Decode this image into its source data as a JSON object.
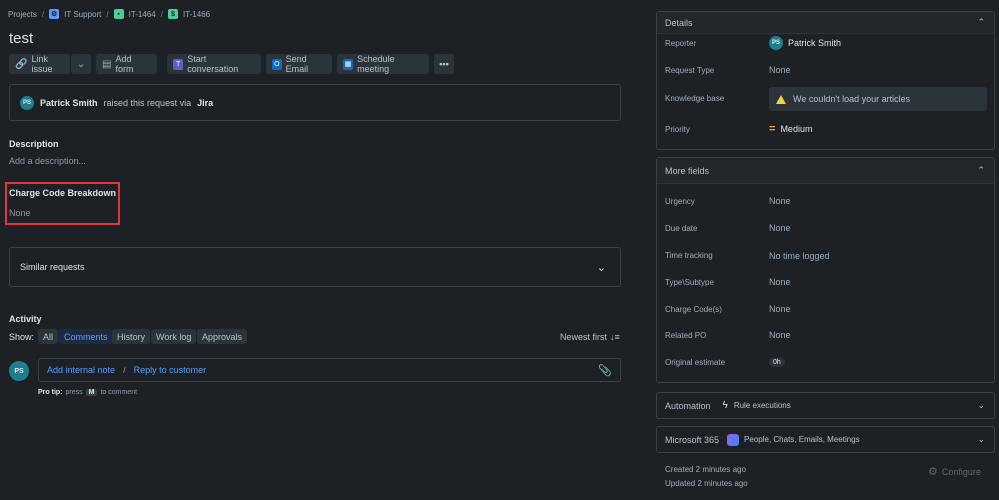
{
  "breadcrumb": {
    "items": [
      {
        "label": "Projects",
        "icon": ""
      },
      {
        "label": "IT Support",
        "icon": "it-support-project-icon"
      },
      {
        "label": "IT-1464",
        "icon": "issue-type-icon"
      },
      {
        "label": "IT-1466",
        "icon": "subtask-icon"
      }
    ]
  },
  "issue": {
    "title": "test"
  },
  "toolbar": {
    "link_issue": "Link issue",
    "add_form": "Add form",
    "start_conversation": "Start conversation",
    "send_email": "Send Email",
    "schedule_meeting": "Schedule meeting"
  },
  "raised": {
    "avatar_initials": "PS",
    "name": "Patrick Smith",
    "text": "raised this request via",
    "channel": "Jira"
  },
  "description": {
    "heading": "Description",
    "placeholder": "Add a description..."
  },
  "charge_code": {
    "heading": "Charge Code Breakdown",
    "value": "None"
  },
  "similar": {
    "label": "Similar requests"
  },
  "activity": {
    "heading": "Activity",
    "show_label": "Show:",
    "filters": [
      "All",
      "Comments",
      "History",
      "Work log",
      "Approvals"
    ],
    "selected_filter": "Comments",
    "sort": "Newest first",
    "avatar_initials": "PS",
    "add_internal_note": "Add internal note",
    "separator": "/",
    "reply_to_customer": "Reply to customer",
    "tip_bold": "Pro tip:",
    "tip_text": "press",
    "tip_key": "M",
    "tip_tail": "to comment"
  },
  "details": {
    "heading": "Details",
    "fields": [
      {
        "label": "Reporter",
        "value": "Patrick Smith",
        "avatar": "PS"
      },
      {
        "label": "Request Type",
        "value": "None"
      },
      {
        "label": "Knowledge base",
        "value": "We couldn't load your articles"
      },
      {
        "label": "Priority",
        "value": "Medium"
      }
    ]
  },
  "more_fields": {
    "heading": "More fields",
    "fields": [
      {
        "label": "Urgency",
        "value": "None"
      },
      {
        "label": "Due date",
        "value": "None"
      },
      {
        "label": "Time tracking",
        "value": "No time logged"
      },
      {
        "label": "Type\\Subtype",
        "value": "None"
      },
      {
        "label": "Charge Code(s)",
        "value": "None"
      },
      {
        "label": "Related PO",
        "value": "None"
      },
      {
        "label": "Original estimate",
        "value": "0h"
      }
    ]
  },
  "automation": {
    "heading": "Automation",
    "sub": "Rule executions"
  },
  "m365": {
    "heading": "Microsoft 365",
    "sub": "People, Chats, Emails, Meetings"
  },
  "footer": {
    "created": "Created 2 minutes ago",
    "updated": "Updated 2 minutes ago",
    "configure": "Configure"
  },
  "colors": {
    "accent": "#579dff",
    "highlight_box": "#e2343f",
    "priority": "#f8a34a"
  }
}
